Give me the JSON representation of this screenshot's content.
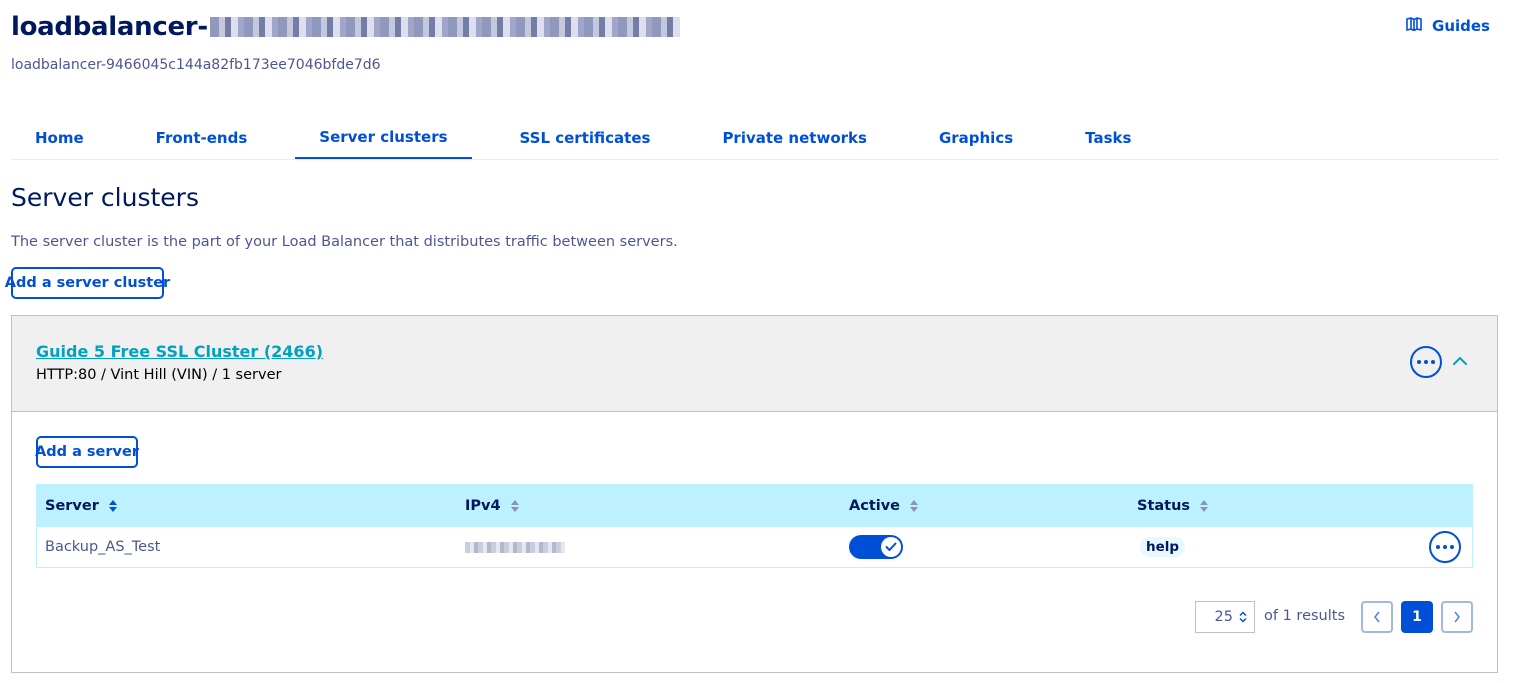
{
  "header": {
    "title_prefix": "loadbalancer-",
    "subtitle": "loadbalancer-9466045c144a82fb173ee7046bfde7d6",
    "guides_label": "Guides"
  },
  "tabs": [
    {
      "label": "Home"
    },
    {
      "label": "Front-ends"
    },
    {
      "label": "Server clusters",
      "active": true
    },
    {
      "label": "SSL certificates"
    },
    {
      "label": "Private networks"
    },
    {
      "label": "Graphics"
    },
    {
      "label": "Tasks"
    }
  ],
  "page": {
    "heading": "Server clusters",
    "description": "The server cluster is the part of your Load Balancer that distributes traffic between servers.",
    "add_cluster_label": "Add a server cluster"
  },
  "cluster": {
    "name": "Guide 5 Free SSL Cluster (2466)",
    "meta": "HTTP:80 / Vint Hill (VIN) / 1 server",
    "add_server_label": "Add a server",
    "table": {
      "columns": [
        "Server",
        "IPv4",
        "Active",
        "Status"
      ],
      "rows": [
        {
          "server": "Backup_AS_Test",
          "ipv4": "",
          "active": true,
          "status": "help"
        }
      ]
    },
    "pagination": {
      "page_size": "25",
      "results_text": "of 1 results",
      "current_page": "1"
    }
  },
  "colors": {
    "primary": "#0050d7",
    "heading": "#00185e",
    "link_teal": "#00a2bf",
    "table_header_bg": "#bef1ff"
  }
}
